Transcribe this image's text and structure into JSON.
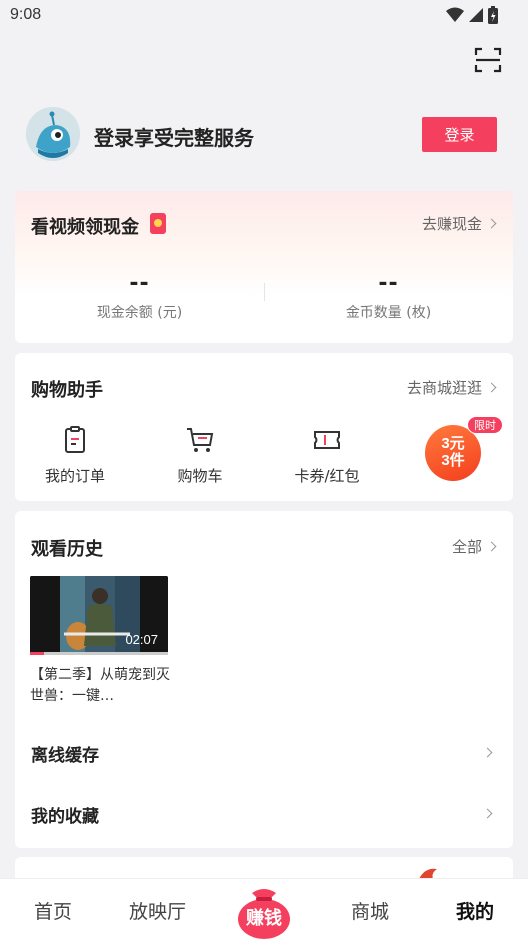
{
  "status_bar": {
    "time": "9:08"
  },
  "profile": {
    "title": "登录享受完整服务",
    "login_button": "登录"
  },
  "cash_card": {
    "title": "看视频领现金",
    "link": "去赚现金",
    "stats": [
      {
        "value": "--",
        "label": "现金余额 (元)"
      },
      {
        "value": "--",
        "label": "金币数量 (枚)"
      }
    ]
  },
  "shopping": {
    "title": "购物助手",
    "link": "去商城逛逛",
    "items": [
      {
        "label": "我的订单",
        "icon": "order-icon"
      },
      {
        "label": "购物车",
        "icon": "cart-icon"
      },
      {
        "label": "卡券/红包",
        "icon": "coupon-icon"
      }
    ],
    "promo": {
      "line1": "3元",
      "line2": "3件",
      "badge": "限时"
    }
  },
  "history": {
    "title": "观看历史",
    "link": "全部",
    "video": {
      "duration": "02:07",
      "title": "【第二季】从萌宠到灭世兽：一键…",
      "progress": 0.1
    },
    "rows": [
      "离线缓存",
      "我的收藏"
    ]
  },
  "tabbar": {
    "tabs": [
      "首页",
      "放映厅",
      "赚钱",
      "商城",
      "我的"
    ],
    "active": "我的"
  },
  "colors": {
    "accent": "#f43f5e"
  }
}
